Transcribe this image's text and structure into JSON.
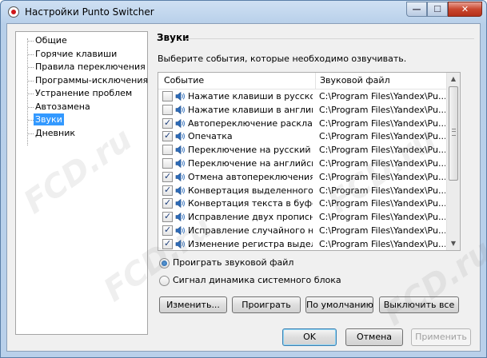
{
  "window": {
    "title": "Настройки Punto Switcher",
    "controls": {
      "minimize": "—",
      "maximize": "☐",
      "close": "✕"
    }
  },
  "sidebar": {
    "items": [
      {
        "label": "Общие",
        "selected": false
      },
      {
        "label": "Горячие клавиши",
        "selected": false
      },
      {
        "label": "Правила переключения",
        "selected": false
      },
      {
        "label": "Программы-исключения",
        "selected": false
      },
      {
        "label": "Устранение проблем",
        "selected": false
      },
      {
        "label": "Автозамена",
        "selected": false
      },
      {
        "label": "Звуки",
        "selected": true
      },
      {
        "label": "Дневник",
        "selected": false
      }
    ]
  },
  "section": {
    "title": "Звуки",
    "description": "Выберите события, которые необходимо озвучивать."
  },
  "table": {
    "columns": [
      "Событие",
      "Звуковой файл"
    ],
    "rows": [
      {
        "event": "Нажатие клавиши в русской...",
        "file": "C:\\Program Files\\Yandex\\Pu...",
        "checked": false
      },
      {
        "event": "Нажатие клавиши в английс...",
        "file": "C:\\Program Files\\Yandex\\Pu...",
        "checked": false
      },
      {
        "event": "Автопереключение раскла...",
        "file": "C:\\Program Files\\Yandex\\Pu...",
        "checked": true
      },
      {
        "event": "Опечатка",
        "file": "C:\\Program Files\\Yandex\\Pu...",
        "checked": true
      },
      {
        "event": "Переключение на русский",
        "file": "C:\\Program Files\\Yandex\\Pu...",
        "checked": false
      },
      {
        "event": "Переключение на английский",
        "file": "C:\\Program Files\\Yandex\\Pu...",
        "checked": false
      },
      {
        "event": "Отмена автопереключения",
        "file": "C:\\Program Files\\Yandex\\Pu...",
        "checked": true
      },
      {
        "event": "Конвертация выделенного ...",
        "file": "C:\\Program Files\\Yandex\\Pu...",
        "checked": true
      },
      {
        "event": "Конвертация текста в буфе...",
        "file": "C:\\Program Files\\Yandex\\Pu...",
        "checked": true
      },
      {
        "event": "Исправление двух прописн...",
        "file": "C:\\Program Files\\Yandex\\Pu...",
        "checked": true
      },
      {
        "event": "Исправление случайного на...",
        "file": "C:\\Program Files\\Yandex\\Pu...",
        "checked": true
      },
      {
        "event": "Изменение регистра выдел...",
        "file": "C:\\Program Files\\Yandex\\Pu...",
        "checked": true
      }
    ]
  },
  "playback": {
    "options": [
      {
        "label": "Проиграть звуковой файл",
        "selected": true
      },
      {
        "label": "Сигнал динамика системного блока",
        "selected": false
      }
    ]
  },
  "actions": {
    "change": "Изменить...",
    "play": "Проиграть",
    "default": "По умолчанию",
    "disable_all": "Выключить все"
  },
  "footer": {
    "ok": "OK",
    "cancel": "Отмена",
    "apply": "Применить"
  },
  "watermark": "FCD.ru"
}
